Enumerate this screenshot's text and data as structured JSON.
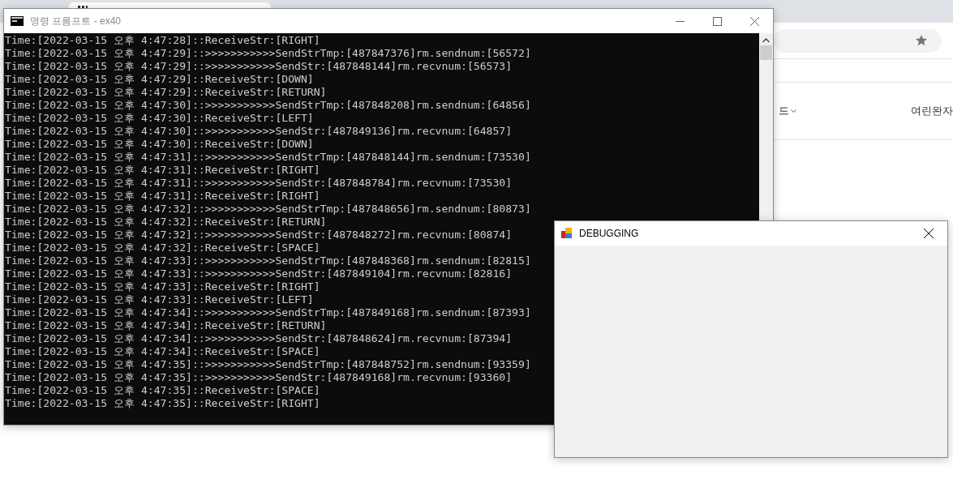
{
  "browser": {
    "nav_items": [
      {
        "label": "드",
        "dropdown": true
      },
      {
        "label": "여린완자",
        "dropdown": false
      }
    ]
  },
  "console": {
    "title": "명령 프롬프트 - ex40",
    "lines": [
      "Time:[2022-03-15 오후 4:47:28]::ReceiveStr:[RIGHT]",
      "Time:[2022-03-15 오후 4:47:29]::>>>>>>>>>>>SendStrTmp:[487847376]rm.sendnum:[56572]",
      "Time:[2022-03-15 오후 4:47:29]::>>>>>>>>>>>SendStr:[487848144]rm.recvnum:[56573]",
      "Time:[2022-03-15 오후 4:47:29]::ReceiveStr:[DOWN]",
      "Time:[2022-03-15 오후 4:47:29]::ReceiveStr:[RETURN]",
      "Time:[2022-03-15 오후 4:47:30]::>>>>>>>>>>>SendStrTmp:[487848208]rm.sendnum:[64856]",
      "Time:[2022-03-15 오후 4:47:30]::ReceiveStr:[LEFT]",
      "Time:[2022-03-15 오후 4:47:30]::>>>>>>>>>>>SendStr:[487849136]rm.recvnum:[64857]",
      "Time:[2022-03-15 오후 4:47:30]::ReceiveStr:[DOWN]",
      "Time:[2022-03-15 오후 4:47:31]::>>>>>>>>>>>SendStrTmp:[487848144]rm.sendnum:[73530]",
      "Time:[2022-03-15 오후 4:47:31]::ReceiveStr:[RIGHT]",
      "Time:[2022-03-15 오후 4:47:31]::>>>>>>>>>>>SendStr:[487848784]rm.recvnum:[73530]",
      "Time:[2022-03-15 오후 4:47:31]::ReceiveStr:[RIGHT]",
      "Time:[2022-03-15 오후 4:47:32]::>>>>>>>>>>>SendStrTmp:[487848656]rm.sendnum:[80873]",
      "Time:[2022-03-15 오후 4:47:32]::ReceiveStr:[RETURN]",
      "Time:[2022-03-15 오후 4:47:32]::>>>>>>>>>>>SendStr:[487848272]rm.recvnum:[80874]",
      "Time:[2022-03-15 오후 4:47:32]::ReceiveStr:[SPACE]",
      "Time:[2022-03-15 오후 4:47:33]::>>>>>>>>>>>SendStrTmp:[487848368]rm.sendnum:[82815]",
      "Time:[2022-03-15 오후 4:47:33]::>>>>>>>>>>>SendStr:[487849104]rm.recvnum:[82816]",
      "Time:[2022-03-15 오후 4:47:33]::ReceiveStr:[RIGHT]",
      "Time:[2022-03-15 오후 4:47:33]::ReceiveStr:[LEFT]",
      "Time:[2022-03-15 오후 4:47:34]::>>>>>>>>>>>SendStrTmp:[487849168]rm.sendnum:[87393]",
      "Time:[2022-03-15 오후 4:47:34]::ReceiveStr:[RETURN]",
      "Time:[2022-03-15 오후 4:47:34]::>>>>>>>>>>>SendStr:[487848624]rm.recvnum:[87394]",
      "Time:[2022-03-15 오후 4:47:34]::ReceiveStr:[SPACE]",
      "Time:[2022-03-15 오후 4:47:35]::>>>>>>>>>>>SendStrTmp:[487848752]rm.sendnum:[93359]",
      "Time:[2022-03-15 오후 4:47:35]::>>>>>>>>>>>SendStr:[487849168]rm.recvnum:[93360]",
      "Time:[2022-03-15 오후 4:47:35]::ReceiveStr:[SPACE]",
      "Time:[2022-03-15 오후 4:47:35]::ReceiveStr:[RIGHT]"
    ]
  },
  "debug_window": {
    "title": "DEBUGGING"
  }
}
